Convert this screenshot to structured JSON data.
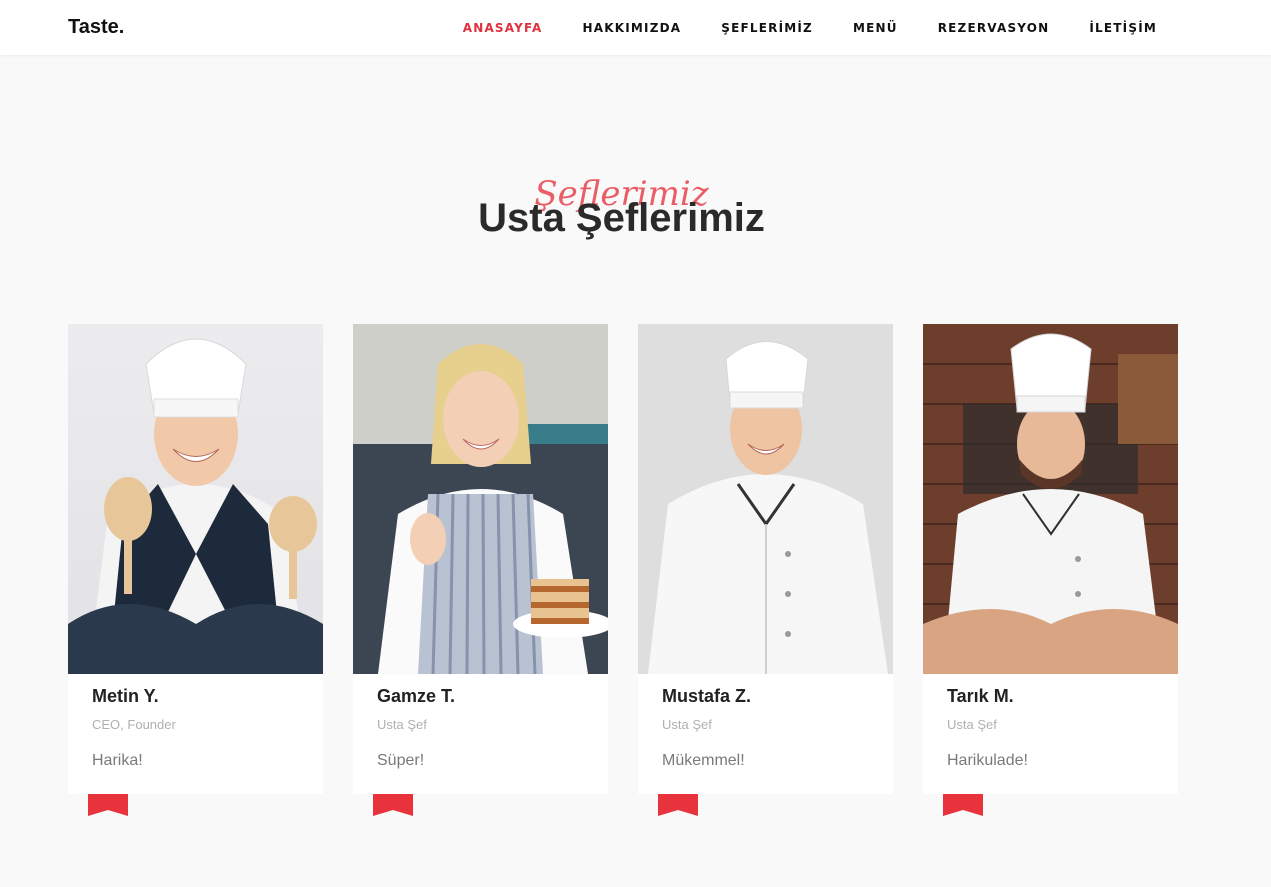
{
  "nav": {
    "brand": "Taste.",
    "items": [
      "ANASAYFA",
      "HAKKIMIZDA",
      "ŞEFLERİMİZ",
      "MENÜ",
      "REZERVASYON",
      "İLETİŞİM"
    ],
    "active": "ANASAYFA"
  },
  "section": {
    "script_title": "Şeflerimiz",
    "title": "Usta Şeflerimiz"
  },
  "chefs": [
    {
      "name": "Metin Y.",
      "role": "CEO, Founder",
      "quote": "Harika!"
    },
    {
      "name": "Gamze T.",
      "role": "Usta Şef",
      "quote": "Süper!"
    },
    {
      "name": "Mustafa Z.",
      "role": "Usta Şef",
      "quote": "Mükemmel!"
    },
    {
      "name": "Tarık M.",
      "role": "Usta Şef",
      "quote": "Harikulade!"
    }
  ],
  "colors": {
    "accent": "#e02f3d",
    "ribbon": "#e8323c"
  }
}
